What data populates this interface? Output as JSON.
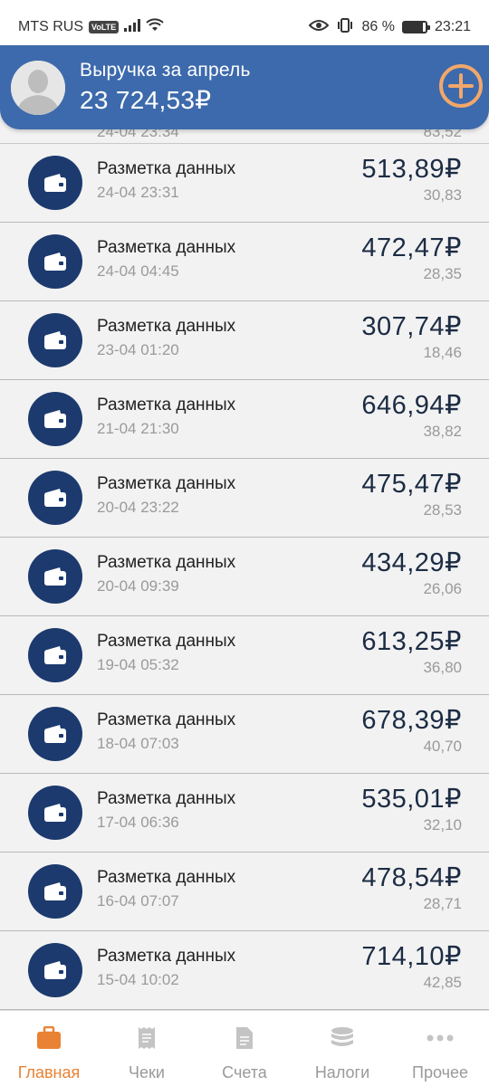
{
  "status_bar": {
    "carrier": "MTS RUS",
    "volte": "VoLTE",
    "battery": "86 %",
    "battery_level": 0.86,
    "time": "23:21"
  },
  "header": {
    "title": "Выручка за апрель",
    "total": "23 724,53₽"
  },
  "partial_row": {
    "date": "24-04 23:34",
    "tax": "83,52"
  },
  "transactions": [
    {
      "title": "Разметка данных",
      "date": "24-04 23:31",
      "amount": "513,89₽",
      "tax": "30,83"
    },
    {
      "title": "Разметка данных",
      "date": "24-04 04:45",
      "amount": "472,47₽",
      "tax": "28,35"
    },
    {
      "title": "Разметка данных",
      "date": "23-04 01:20",
      "amount": "307,74₽",
      "tax": "18,46"
    },
    {
      "title": "Разметка данных",
      "date": "21-04 21:30",
      "amount": "646,94₽",
      "tax": "38,82"
    },
    {
      "title": "Разметка данных",
      "date": "20-04 23:22",
      "amount": "475,47₽",
      "tax": "28,53"
    },
    {
      "title": "Разметка данных",
      "date": "20-04 09:39",
      "amount": "434,29₽",
      "tax": "26,06"
    },
    {
      "title": "Разметка данных",
      "date": "19-04 05:32",
      "amount": "613,25₽",
      "tax": "36,80"
    },
    {
      "title": "Разметка данных",
      "date": "18-04 07:03",
      "amount": "678,39₽",
      "tax": "40,70"
    },
    {
      "title": "Разметка данных",
      "date": "17-04 06:36",
      "amount": "535,01₽",
      "tax": "32,10"
    },
    {
      "title": "Разметка данных",
      "date": "16-04 07:07",
      "amount": "478,54₽",
      "tax": "28,71"
    },
    {
      "title": "Разметка данных",
      "date": "15-04 10:02",
      "amount": "714,10₽",
      "tax": "42,85"
    }
  ],
  "nav": [
    {
      "label": "Главная",
      "icon": "briefcase-icon",
      "active": true
    },
    {
      "label": "Чеки",
      "icon": "receipt-icon",
      "active": false
    },
    {
      "label": "Счета",
      "icon": "document-icon",
      "active": false
    },
    {
      "label": "Налоги",
      "icon": "coins-icon",
      "active": false
    },
    {
      "label": "Прочее",
      "icon": "more-icon",
      "active": false
    }
  ],
  "colors": {
    "header_bg": "#3d6aac",
    "accent_orange": "#e98234",
    "icon_circle": "#1c3a6e",
    "amount_text": "#1c2c44"
  }
}
